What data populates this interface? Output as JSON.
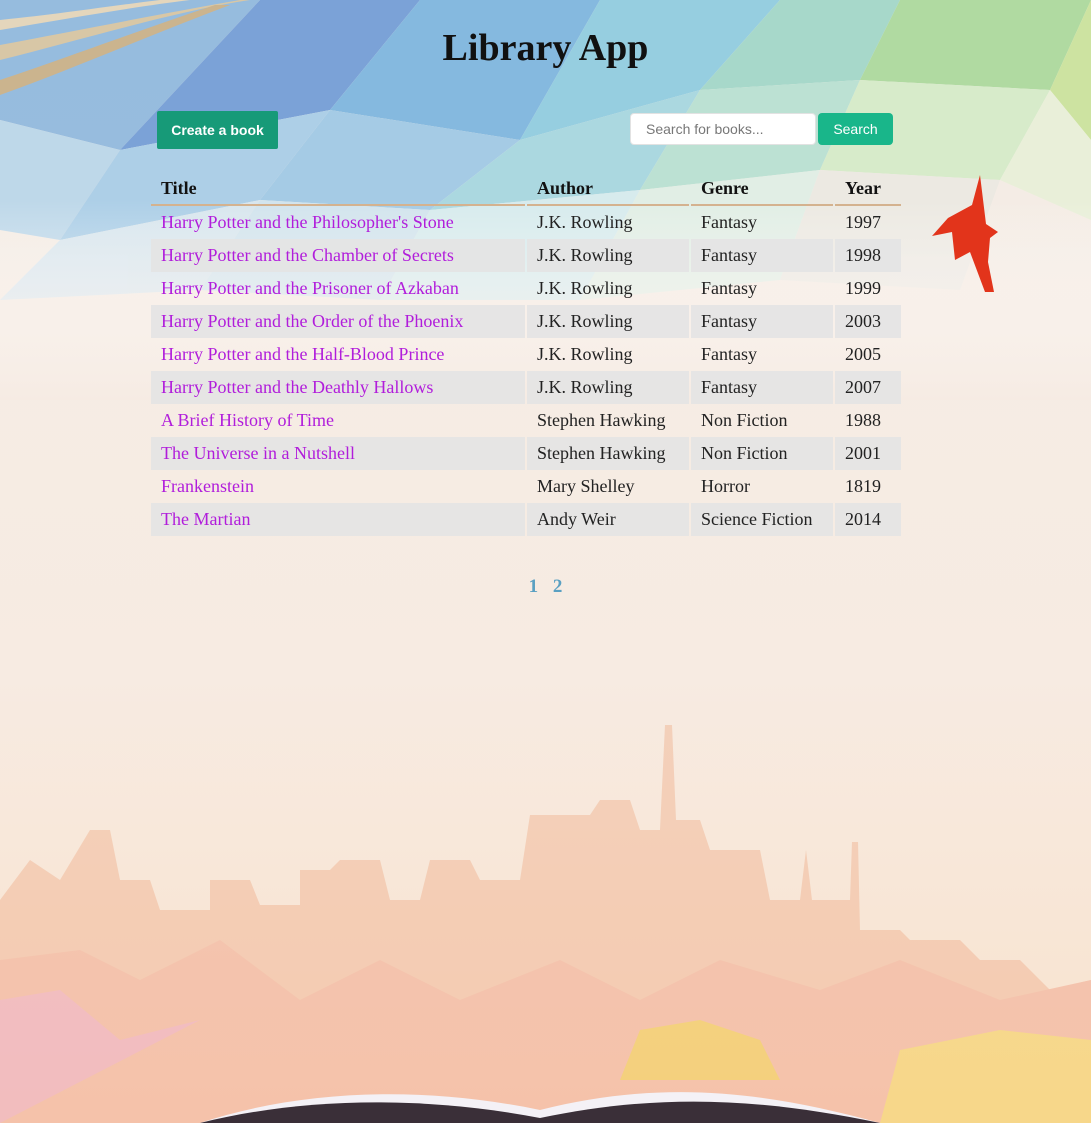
{
  "app": {
    "title": "Library App"
  },
  "toolbar": {
    "create_label": "Create a book",
    "search_placeholder": "Search for books...",
    "search_value": "",
    "search_label": "Search"
  },
  "table": {
    "headers": [
      "Title",
      "Author",
      "Genre",
      "Year"
    ],
    "rows": [
      {
        "title": "Harry Potter and the Philosopher's Stone",
        "author": "J.K. Rowling",
        "genre": "Fantasy",
        "year": "1997"
      },
      {
        "title": "Harry Potter and the Chamber of Secrets",
        "author": "J.K. Rowling",
        "genre": "Fantasy",
        "year": "1998"
      },
      {
        "title": "Harry Potter and the Prisoner of Azkaban",
        "author": "J.K. Rowling",
        "genre": "Fantasy",
        "year": "1999"
      },
      {
        "title": "Harry Potter and the Order of the Phoenix",
        "author": "J.K. Rowling",
        "genre": "Fantasy",
        "year": "2003"
      },
      {
        "title": "Harry Potter and the Half-Blood Prince",
        "author": "J.K. Rowling",
        "genre": "Fantasy",
        "year": "2005"
      },
      {
        "title": "Harry Potter and the Deathly Hallows",
        "author": "J.K. Rowling",
        "genre": "Fantasy",
        "year": "2007"
      },
      {
        "title": "A Brief History of Time",
        "author": "Stephen Hawking",
        "genre": "Non Fiction",
        "year": "1988"
      },
      {
        "title": "The Universe in a Nutshell",
        "author": "Stephen Hawking",
        "genre": "Non Fiction",
        "year": "2001"
      },
      {
        "title": "Frankenstein",
        "author": "Mary Shelley",
        "genre": "Horror",
        "year": "1819"
      },
      {
        "title": "The Martian",
        "author": "Andy Weir",
        "genre": "Science Fiction",
        "year": "2014"
      }
    ]
  },
  "pagination": {
    "pages": [
      "1",
      "2"
    ]
  },
  "colors": {
    "create_button": "#179a78",
    "search_button": "#19b68a",
    "title_link": "#b11ddb",
    "header_underline": "#d4b28f",
    "pagination_link": "#5aa0c2"
  },
  "decor": {
    "background": "low-poly watercolor sky with city skyline and open book",
    "icons": [
      "rope-icon",
      "bird-icon",
      "open-book-icon"
    ]
  }
}
